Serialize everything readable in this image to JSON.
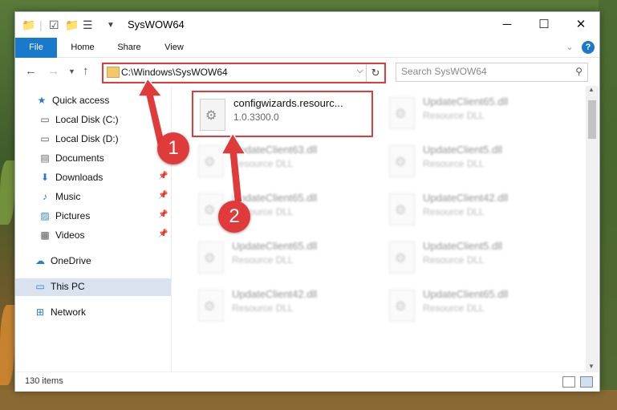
{
  "window": {
    "title": "SysWOW64",
    "controls": {
      "minimize": "─",
      "maximize": "☐",
      "close": "✕"
    }
  },
  "ribbon": {
    "tabs": [
      "File",
      "Home",
      "Share",
      "View"
    ],
    "help_icon": "?",
    "expand_icon": "⌄"
  },
  "nav": {
    "address": "C:\\Windows\\SysWOW64",
    "search_placeholder": "Search SysWOW64"
  },
  "sidebar": {
    "items": [
      {
        "label": "Quick access",
        "icon": "star-icon",
        "pinned": false
      },
      {
        "label": "Local Disk (C:)",
        "icon": "drive-icon",
        "pinned": false
      },
      {
        "label": "Local Disk (D:)",
        "icon": "drive-icon",
        "pinned": false
      },
      {
        "label": "Documents",
        "icon": "documents-icon",
        "pinned": false
      },
      {
        "label": "Downloads",
        "icon": "downloads-icon",
        "pinned": true
      },
      {
        "label": "Music",
        "icon": "music-icon",
        "pinned": true
      },
      {
        "label": "Pictures",
        "icon": "pictures-icon",
        "pinned": true
      },
      {
        "label": "Videos",
        "icon": "videos-icon",
        "pinned": true
      },
      {
        "label": "OneDrive",
        "icon": "cloud-icon",
        "pinned": false
      },
      {
        "label": "This PC",
        "icon": "pc-icon",
        "pinned": false,
        "selected": true
      },
      {
        "label": "Network",
        "icon": "network-icon",
        "pinned": false
      }
    ]
  },
  "files": {
    "highlighted": {
      "name": "configwizards.resourc...",
      "sub": "1.0.3300.0"
    },
    "others": [
      {
        "name": "UpdateClient65.dll",
        "sub": "Resource DLL"
      },
      {
        "name": "UpdateClient63.dll",
        "sub": "Resource DLL"
      },
      {
        "name": "UpdateClient5.dll",
        "sub": "Resource DLL"
      },
      {
        "name": "UpdateClient65.dll",
        "sub": "Resource DLL"
      },
      {
        "name": "UpdateClient42.dll",
        "sub": "Resource DLL"
      },
      {
        "name": "UpdateClient65.dll",
        "sub": "Resource DLL"
      },
      {
        "name": "UpdateClient5.dll",
        "sub": "Resource DLL"
      },
      {
        "name": "UpdateClient42.dll",
        "sub": "Resource DLL"
      },
      {
        "name": "UpdateClient65.dll",
        "sub": "Resource DLL"
      }
    ]
  },
  "status": {
    "count": "130 items"
  },
  "annotations": {
    "step1": "1",
    "step2": "2"
  },
  "colors": {
    "accent": "#1979ca",
    "highlight": "#e03a3a"
  }
}
